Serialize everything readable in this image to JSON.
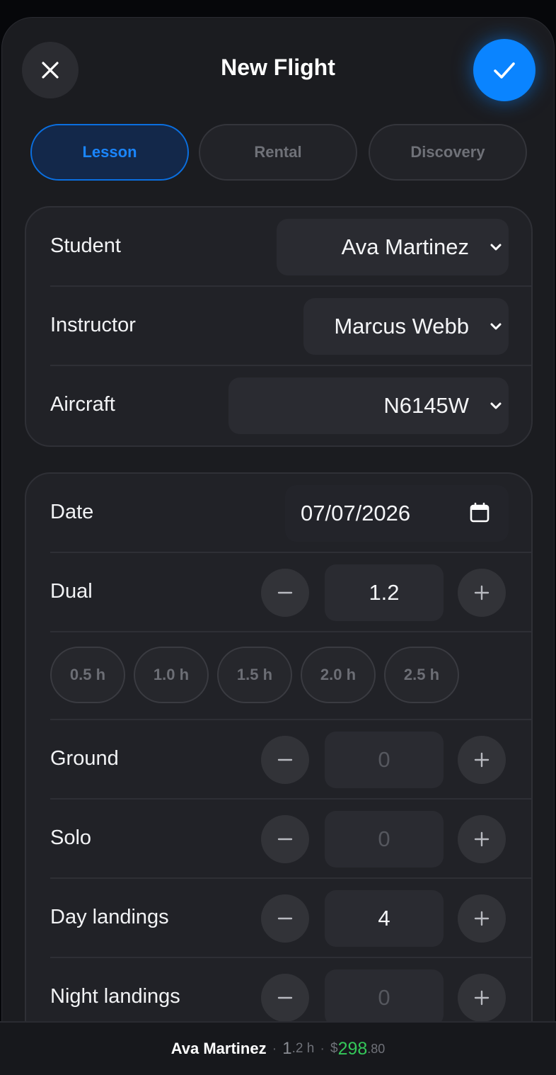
{
  "header": {
    "title": "New Flight",
    "close_icon": "close-icon",
    "save_icon": "checkmark-icon",
    "accent": "#0a84ff"
  },
  "tabs": [
    {
      "label": "Lesson",
      "active": true
    },
    {
      "label": "Rental",
      "active": false
    },
    {
      "label": "Discovery",
      "active": false
    }
  ],
  "people": {
    "student": {
      "label": "Student",
      "value": "Ava Martinez"
    },
    "instructor": {
      "label": "Instructor",
      "value": "Marcus Webb"
    },
    "aircraft": {
      "label": "Aircraft",
      "value": "N6145W"
    }
  },
  "times": {
    "date": {
      "label": "Date",
      "value": "07/07/2026"
    },
    "dual": {
      "label": "Dual",
      "value": "1.2"
    },
    "presets": [
      "0.5 h",
      "1.0 h",
      "1.5 h",
      "2.0 h",
      "2.5 h"
    ],
    "ground": {
      "label": "Ground",
      "value": "0"
    },
    "solo": {
      "label": "Solo",
      "value": "0"
    },
    "day_landings": {
      "label": "Day landings",
      "value": "4"
    },
    "night_landings": {
      "label": "Night landings",
      "value": "0"
    }
  },
  "summary": {
    "name": "Ava Martinez",
    "separator": "·",
    "hours_int": "1",
    "hours_frac": ".2 h",
    "currency": "$",
    "amount_int": "298",
    "amount_frac": ".80",
    "amount_color": "#34c759"
  }
}
